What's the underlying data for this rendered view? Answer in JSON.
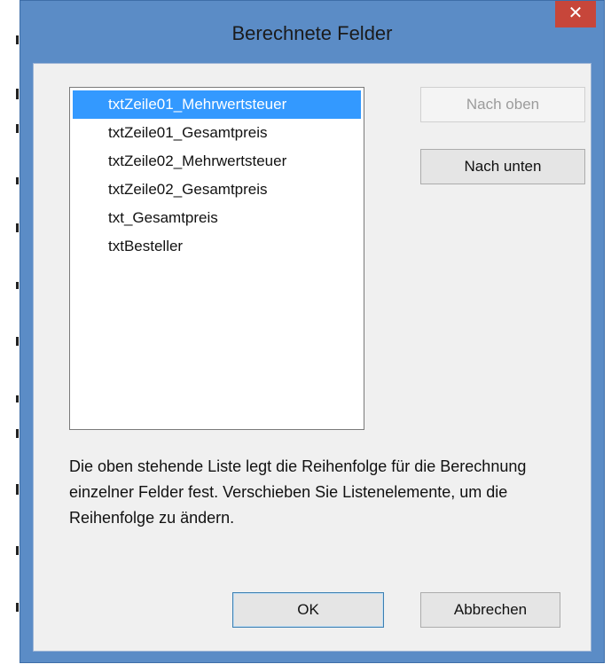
{
  "window": {
    "title": "Berechnete Felder",
    "close_label": "✕"
  },
  "list": {
    "items": [
      {
        "label": "txtZeile01_Mehrwertsteuer",
        "selected": true
      },
      {
        "label": "txtZeile01_Gesamtpreis",
        "selected": false
      },
      {
        "label": "txtZeile02_Mehrwertsteuer",
        "selected": false
      },
      {
        "label": "txtZeile02_Gesamtpreis",
        "selected": false
      },
      {
        "label": "txt_Gesamtpreis",
        "selected": false
      },
      {
        "label": "txtBesteller",
        "selected": false
      }
    ]
  },
  "buttons": {
    "move_up": "Nach oben",
    "move_down": "Nach unten",
    "ok": "OK",
    "cancel": "Abbrechen"
  },
  "description": "Die oben stehende Liste legt die Reihenfolge für die Berechnung einzelner Felder fest. Verschieben Sie Listenelemente, um die Reihenfolge zu ändern.",
  "colors": {
    "frame": "#5b8cc6",
    "close_button": "#c7463a",
    "selection": "#3399ff"
  }
}
